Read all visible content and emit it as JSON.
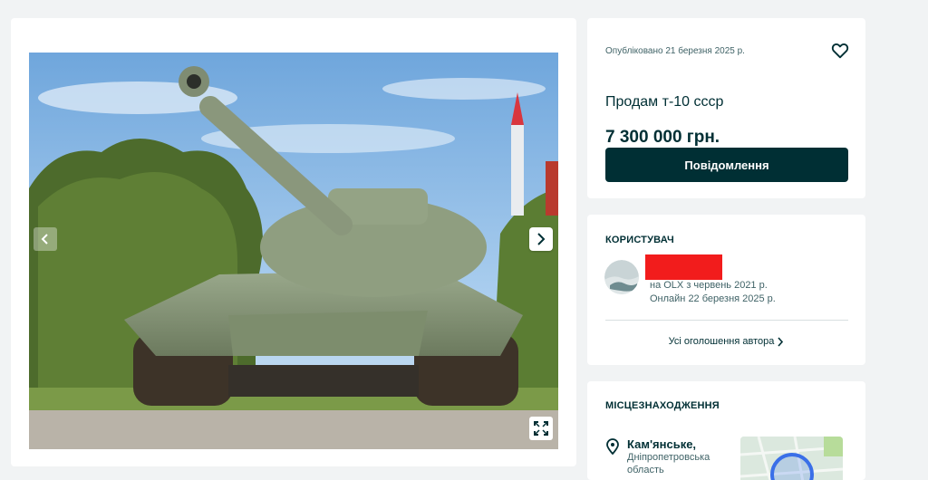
{
  "listing": {
    "published": "Опубліковано 21 березня 2025 р.",
    "title": "Продам т-10 ссср",
    "price": "7 300 000 грн.",
    "message_button": "Повідомлення"
  },
  "seller": {
    "heading": "Користувач",
    "name_redacted": true,
    "redaction_color": "#f21c1c",
    "member_since": "на OLX з червень 2021 р.",
    "online": "Онлайн 22 березня 2025 р.",
    "all_ads_link": "Усі оголошення автора"
  },
  "location": {
    "heading": "Місцезнаходження",
    "city": "Кам'янське,",
    "region": "Дніпропетровська область"
  },
  "icons": {
    "favorite": "heart-icon",
    "prev": "chevron-left-icon",
    "next": "chevron-right-icon",
    "fullscreen": "expand-icon",
    "pin": "location-pin-icon",
    "link_chevron": "chevron-right-icon"
  },
  "colors": {
    "brand_dark": "#002f34",
    "muted_text": "#406367",
    "page_bg": "#f1f3f4"
  }
}
